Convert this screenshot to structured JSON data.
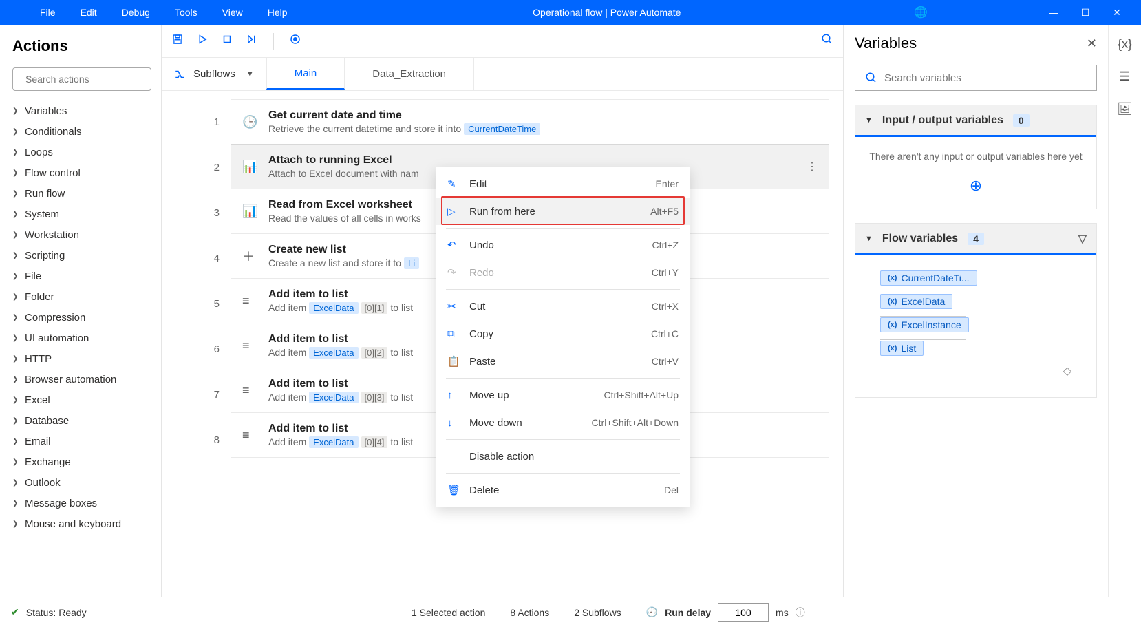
{
  "titlebar": {
    "menus": [
      "File",
      "Edit",
      "Debug",
      "Tools",
      "View",
      "Help"
    ],
    "title": "Operational flow | Power Automate"
  },
  "leftPanel": {
    "heading": "Actions",
    "searchPlaceholder": "Search actions",
    "categories": [
      "Variables",
      "Conditionals",
      "Loops",
      "Flow control",
      "Run flow",
      "System",
      "Workstation",
      "Scripting",
      "File",
      "Folder",
      "Compression",
      "UI automation",
      "HTTP",
      "Browser automation",
      "Excel",
      "Database",
      "Email",
      "Exchange",
      "Outlook",
      "Message boxes",
      "Mouse and keyboard"
    ]
  },
  "subflows": {
    "label": "Subflows",
    "tabs": [
      "Main",
      "Data_Extraction"
    ]
  },
  "steps": [
    {
      "n": "1",
      "title": "Get current date and time",
      "desc_pre": "Retrieve the current datetime and store it into",
      "token": "CurrentDateTime"
    },
    {
      "n": "2",
      "title": "Attach to running Excel",
      "desc_pre": "Attach to Excel document with nam",
      "selected": true
    },
    {
      "n": "3",
      "title": "Read from Excel worksheet",
      "desc_pre": "Read the values of all cells in works"
    },
    {
      "n": "4",
      "title": "Create new list",
      "desc_pre": "Create a new list and store it to",
      "token": "Li"
    },
    {
      "n": "5",
      "title": "Add item to list",
      "desc_pre": "Add item",
      "token": "ExcelData",
      "idx": "[0][1]",
      "desc_post": "to list"
    },
    {
      "n": "6",
      "title": "Add item to list",
      "desc_pre": "Add item",
      "token": "ExcelData",
      "idx": "[0][2]",
      "desc_post": "to list"
    },
    {
      "n": "7",
      "title": "Add item to list",
      "desc_pre": "Add item",
      "token": "ExcelData",
      "idx": "[0][3]",
      "desc_post": "to list"
    },
    {
      "n": "8",
      "title": "Add item to list",
      "desc_pre": "Add item",
      "token": "ExcelData",
      "idx": "[0][4]",
      "desc_post": "to list"
    }
  ],
  "contextMenu": [
    {
      "icon": "edit",
      "label": "Edit",
      "short": "Enter"
    },
    {
      "icon": "play",
      "label": "Run from here",
      "short": "Alt+F5",
      "highlight": true
    },
    {
      "sep": true
    },
    {
      "icon": "undo",
      "label": "Undo",
      "short": "Ctrl+Z"
    },
    {
      "icon": "redo",
      "label": "Redo",
      "short": "Ctrl+Y",
      "disabled": true
    },
    {
      "sep": true
    },
    {
      "icon": "cut",
      "label": "Cut",
      "short": "Ctrl+X"
    },
    {
      "icon": "copy",
      "label": "Copy",
      "short": "Ctrl+C"
    },
    {
      "icon": "paste",
      "label": "Paste",
      "short": "Ctrl+V"
    },
    {
      "sep": true
    },
    {
      "icon": "up",
      "label": "Move up",
      "short": "Ctrl+Shift+Alt+Up"
    },
    {
      "icon": "down",
      "label": "Move down",
      "short": "Ctrl+Shift+Alt+Down"
    },
    {
      "sep": true
    },
    {
      "icon": "",
      "label": "Disable action",
      "short": ""
    },
    {
      "sep": true
    },
    {
      "icon": "delete",
      "label": "Delete",
      "short": "Del"
    }
  ],
  "variables": {
    "heading": "Variables",
    "searchPlaceholder": "Search variables",
    "ioTitle": "Input / output variables",
    "ioCount": "0",
    "ioEmpty": "There aren't any input or output variables here yet",
    "flowTitle": "Flow variables",
    "flowCount": "4",
    "chips": [
      "CurrentDateTi...",
      "ExcelData",
      "ExcelInstance",
      "List"
    ]
  },
  "status": {
    "ready": "Status: Ready",
    "selected": "1 Selected action",
    "actions": "8 Actions",
    "subflows": "2 Subflows",
    "runDelayLabel": "Run delay",
    "runDelayValue": "100",
    "ms": "ms"
  }
}
